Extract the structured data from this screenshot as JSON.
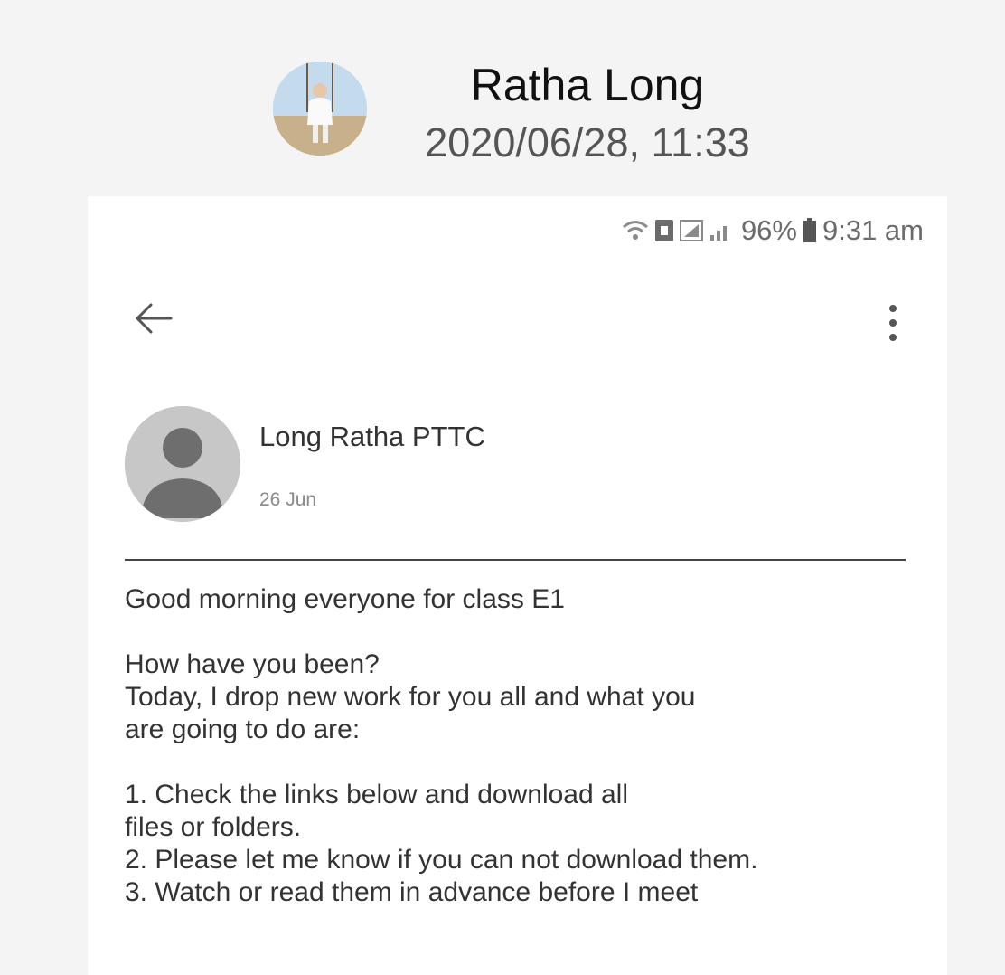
{
  "header": {
    "name": "Ratha Long",
    "timestamp": "2020/06/28, 11:33",
    "avatar_icon": "profile-photo"
  },
  "status_bar": {
    "battery": "96%",
    "time": "9:31 am",
    "icons": [
      "wifi-icon",
      "sim-icon",
      "signal-icon",
      "battery-icon"
    ]
  },
  "toolbar": {
    "back_icon": "arrow-left-icon",
    "menu_icon": "more-vertical-icon"
  },
  "message": {
    "sender": "Long Ratha PTTC",
    "date": "26 Jun",
    "lines": [
      "Good morning everyone for class E1",
      "",
      "How have you been?",
      "Today, I drop new work for you all and what you",
      "are going to do are:",
      "",
      "1. Check the links below and download all",
      "files or folders.",
      "2. Please let me know if you can not download them.",
      "3. Watch or read them in advance before I meet"
    ]
  },
  "colors": {
    "background": "#f4f4f4",
    "phone_bg": "#ffffff",
    "avatar_grey": "#c7c7c7",
    "text": "#333333"
  }
}
